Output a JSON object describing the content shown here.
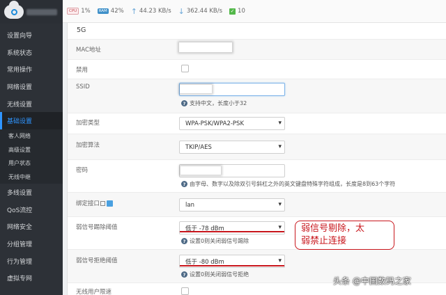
{
  "topbar": {
    "cpu_chip": "CPU",
    "cpu": "1%",
    "ram_chip": "RAM",
    "ram": "42%",
    "upload": "44.23 KB/s",
    "download": "362.44 KB/s",
    "connections": "10"
  },
  "sidebar": {
    "items": [
      {
        "label": "设置向导"
      },
      {
        "label": "系统状态"
      },
      {
        "label": "常用操作"
      },
      {
        "label": "网络设置"
      },
      {
        "label": "无线设置"
      },
      {
        "label": "基础设置"
      }
    ],
    "subitems": [
      {
        "label": "客人网络"
      },
      {
        "label": "高级设置"
      },
      {
        "label": "用户状态"
      },
      {
        "label": "无线中继"
      }
    ],
    "items2": [
      {
        "label": "多线设置"
      },
      {
        "label": "QoS流控"
      },
      {
        "label": "网络安全"
      },
      {
        "label": "分组管理"
      },
      {
        "label": "行为管理"
      },
      {
        "label": "虚拟专网"
      }
    ]
  },
  "form": {
    "section_title": "5G",
    "mac_label": "MAC地址",
    "disable_label": "禁用",
    "ssid_label": "SSID",
    "ssid_hint": "支持中文，长度小于32",
    "enc_type_label": "加密类型",
    "enc_type_value": "WPA-PSK/WPA2-PSK",
    "enc_algo_label": "加密算法",
    "enc_algo_value": "TKIP/AES",
    "password_label": "密码",
    "password_hint": "由字母、数字以及除双引号斜杠之外的英文键盘特殊字符组成，长度是8到63个字符",
    "bind_label": "绑定接口",
    "bind_value": "lan",
    "kick_label": "弱信号踢除阈值",
    "kick_value": "低于 -78 dBm",
    "kick_hint": "设置0则关闭弱信号踢除",
    "reject_label": "弱信号拒绝阈值",
    "reject_value": "低于 -80 dBm",
    "reject_hint": "设置0则关闭弱信号拒绝",
    "ratelimit_label": "无线用户限速"
  },
  "callout": {
    "line1": "弱信号剔除，太",
    "line2": "弱禁止连接"
  },
  "watermark": "头条 @中国数码之家",
  "colors": {
    "accent": "#2f95ff",
    "annotation": "#c8151b",
    "sidebar": "#2d3137"
  }
}
